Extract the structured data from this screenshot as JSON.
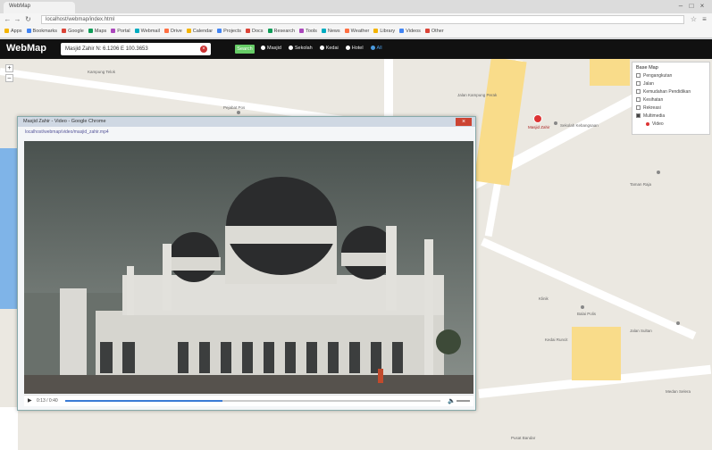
{
  "browser": {
    "tab_title": "WebMap",
    "address": "localhost/webmap/index.html",
    "bookmarks": [
      "Apps",
      "Bookmarks",
      "Google",
      "Maps",
      "Portal",
      "Webmail",
      "Drive",
      "Calendar",
      "Projects",
      "Docs",
      "Research",
      "Tools",
      "News",
      "Weather",
      "Library",
      "Videos",
      "Other"
    ]
  },
  "app": {
    "logo": "WebMap",
    "search_value": "Masjid Zahir N: 6.1206 E 100.3653",
    "search_clear": "×",
    "go_label": "Search",
    "filters": [
      "Masjid",
      "Sekolah",
      "Kedai",
      "Hotel"
    ],
    "filter_extra": "All"
  },
  "legend": {
    "title": "Base Map",
    "items": [
      "Pengangkutan",
      "Jalan",
      "Kemudahan Pendidikan",
      "Kesihatan",
      "Rekreasi",
      "Multimedia",
      "Video"
    ]
  },
  "map_labels": [
    "Masjid Zahir",
    "Kampung Telok",
    "Sekolah Kebangsaan",
    "Jalan Kampung Perak",
    "Pejabat Pos",
    "Taman Raja",
    "Klinik",
    "Balai Polis",
    "Kedai Runcit",
    "Jalan Sultan",
    "Medan Selera",
    "Pusat Bandar"
  ],
  "popup": {
    "title": "Masjid Zahir - Video - Google Chrome",
    "link": "localhost/webmap/video/masjid_zahir.mp4",
    "close": "×",
    "time": "0:13 / 0:40",
    "progress": 0.42,
    "volume": 0.8
  },
  "colors": {
    "app_bar": "#111111",
    "accent": "#d33333",
    "road_yellow": "#f9dc8a",
    "river": "#7fb4e8"
  }
}
